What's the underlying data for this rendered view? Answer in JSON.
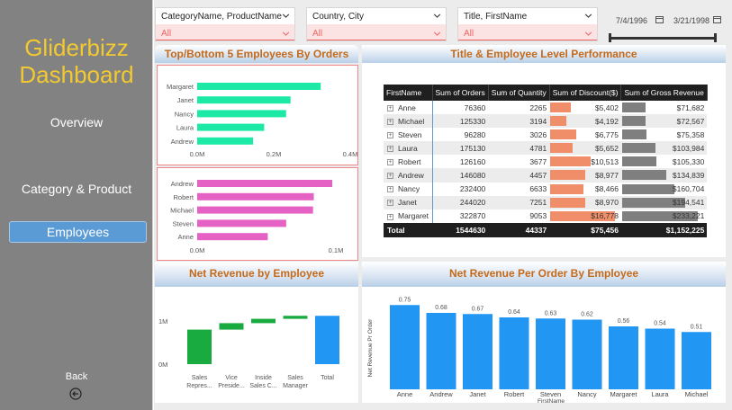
{
  "sidebar": {
    "logo_line1": "Gliderbizz",
    "logo_line2": "Dashboard",
    "nav": [
      {
        "label": "Overview",
        "active": false
      },
      {
        "label": "Category & Product",
        "active": false
      },
      {
        "label": "Employees",
        "active": true
      }
    ],
    "back_label": "Back"
  },
  "filters": {
    "slicers": [
      {
        "label": "CategoryName, ProductName",
        "value": "All"
      },
      {
        "label": "Country, City",
        "value": "All"
      },
      {
        "label": "Title, FirstName",
        "value": "All"
      }
    ],
    "date_start": "7/4/1996",
    "date_end": "3/21/1998"
  },
  "top_bottom": {
    "title": "Top/Bottom 5 Employees By Orders",
    "top_chart": {
      "type": "bar",
      "orientation": "horizontal",
      "categories": [
        "Margaret",
        "Janet",
        "Nancy",
        "Laura",
        "Andrew"
      ],
      "values": [
        322870,
        244020,
        232400,
        175130,
        146080
      ],
      "xlim": [
        0,
        400000
      ],
      "ticks": [
        "0.0M",
        "0.2M",
        "0.4M"
      ],
      "color": "#1de9a6"
    },
    "bottom_chart": {
      "type": "bar",
      "orientation": "horizontal",
      "categories": [
        "Andrew",
        "Robert",
        "Michael",
        "Steven",
        "Anne"
      ],
      "values": [
        146080,
        126160,
        125330,
        96280,
        76360
      ],
      "xlim": [
        0,
        150000
      ],
      "ticks": [
        "0.0M",
        "0.1M"
      ],
      "color": "#e561c3"
    }
  },
  "performance": {
    "title": "Title & Employee Level Performance",
    "columns": [
      "FirstName",
      "Sum of Orders",
      "Sum of Quantity",
      "Sum of Discount($)",
      "Sum of Gross Revenue"
    ],
    "rows": [
      {
        "name": "Anne",
        "orders": "76360",
        "qty": "2265",
        "disc": "$5,402",
        "disc_val": 5402,
        "gross": "$71,682",
        "gross_val": 71682
      },
      {
        "name": "Michael",
        "orders": "125330",
        "qty": "3194",
        "disc": "$4,192",
        "disc_val": 4192,
        "gross": "$72,567",
        "gross_val": 72567
      },
      {
        "name": "Steven",
        "orders": "96280",
        "qty": "3026",
        "disc": "$6,775",
        "disc_val": 6775,
        "gross": "$75,358",
        "gross_val": 75358
      },
      {
        "name": "Laura",
        "orders": "175130",
        "qty": "4781",
        "disc": "$5,652",
        "disc_val": 5652,
        "gross": "$103,984",
        "gross_val": 103984
      },
      {
        "name": "Robert",
        "orders": "126160",
        "qty": "3677",
        "disc": "$10,513",
        "disc_val": 10513,
        "gross": "$105,330",
        "gross_val": 105330
      },
      {
        "name": "Andrew",
        "orders": "146080",
        "qty": "4457",
        "disc": "$8,977",
        "disc_val": 8977,
        "gross": "$134,839",
        "gross_val": 134839
      },
      {
        "name": "Nancy",
        "orders": "232400",
        "qty": "6633",
        "disc": "$8,466",
        "disc_val": 8466,
        "gross": "$160,704",
        "gross_val": 160704
      },
      {
        "name": "Janet",
        "orders": "244020",
        "qty": "7251",
        "disc": "$8,970",
        "disc_val": 8970,
        "gross": "$194,541",
        "gross_val": 194541
      },
      {
        "name": "Margaret",
        "orders": "322870",
        "qty": "9053",
        "disc": "$16,778",
        "disc_val": 16778,
        "gross": "$233,221",
        "gross_val": 233221
      }
    ],
    "total": {
      "name": "Total",
      "orders": "1544630",
      "qty": "44337",
      "disc": "$75,456",
      "gross": "$1,152,225"
    }
  },
  "net_revenue_employee": {
    "title": "Net Revenue by Employee",
    "chart": {
      "type": "waterfall",
      "categories": [
        [
          "Sales",
          "Repres..."
        ],
        [
          "Vice",
          "Preside..."
        ],
        [
          "Inside",
          "Sales C..."
        ],
        [
          "Sales",
          "Manager"
        ],
        [
          "Total"
        ]
      ],
      "values": [
        0.8,
        0.15,
        0.1,
        0.07,
        1.12
      ],
      "ylim": [
        0,
        1.25
      ],
      "yticks": [
        "0M",
        "1M"
      ],
      "colors": {
        "first": "#1aab40",
        "increase": "#1aab40",
        "total": "#2196f3"
      }
    }
  },
  "net_revenue_order": {
    "title": "Net Revenue Per Order By Employee",
    "chart_data": {
      "type": "bar",
      "categories": [
        "Anne",
        "Andrew",
        "Janet",
        "Robert",
        "Steven",
        "Nancy",
        "Margaret",
        "Laura",
        "Michael"
      ],
      "values": [
        0.75,
        0.68,
        0.67,
        0.64,
        0.63,
        0.62,
        0.56,
        0.54,
        0.51
      ],
      "labels": [
        "0.75",
        "0.68",
        "0.67",
        "0.64",
        "0.63",
        "0.62",
        "0.56",
        "0.54",
        "0.51"
      ],
      "xlabel": "FirstName",
      "ylabel": "Net Revenue Pr Order",
      "ylim": [
        0,
        0.8
      ],
      "color": "#2196f3"
    }
  }
}
